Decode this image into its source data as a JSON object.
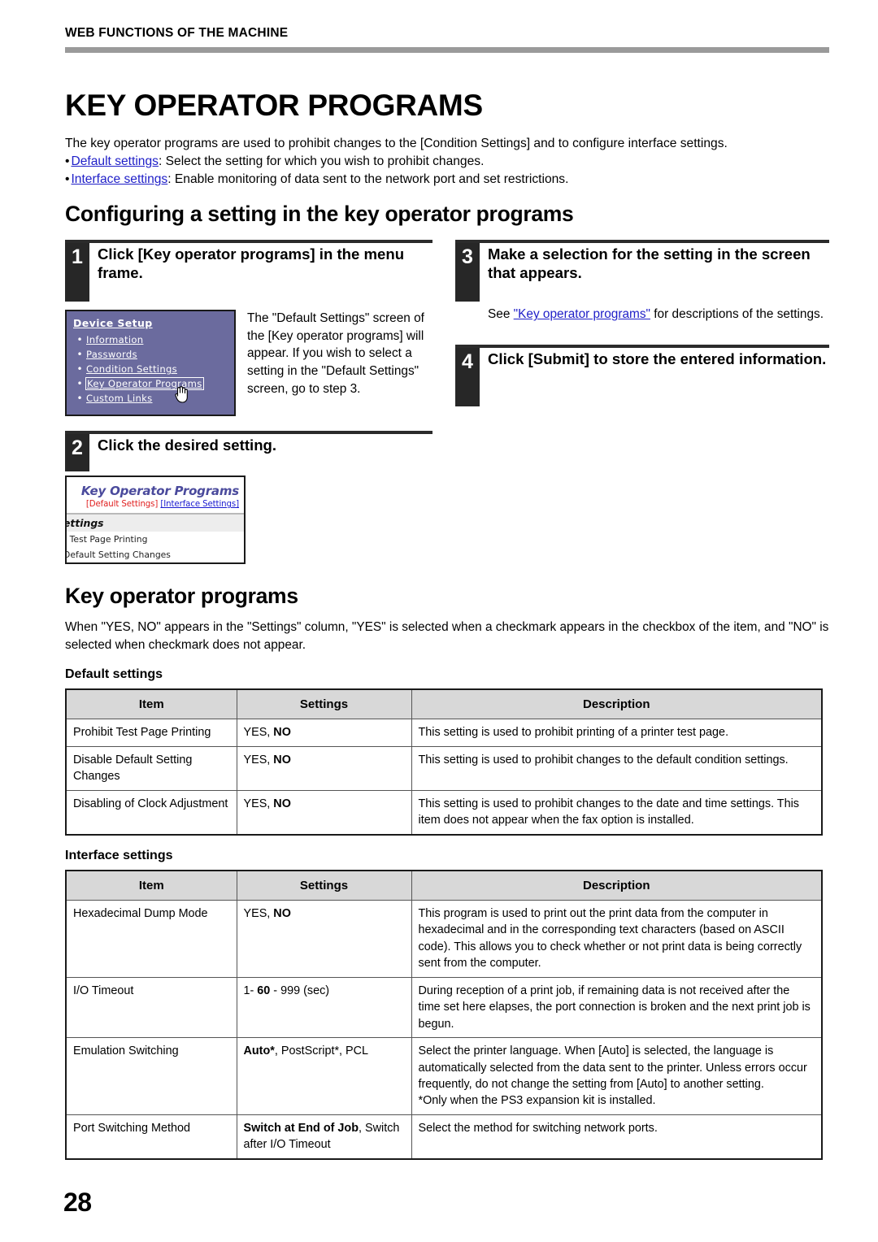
{
  "running_header": "WEB FUNCTIONS OF THE MACHINE",
  "doc_title": "KEY OPERATOR PROGRAMS",
  "intro": "The key operator programs are used to prohibit changes to the [Condition Settings] and to configure interface settings.",
  "bullets": [
    {
      "bullet": "•",
      "link": "Default settings",
      "rest": ": Select the setting for which you wish to prohibit changes."
    },
    {
      "bullet": "•",
      "link": "Interface settings",
      "rest": ": Enable monitoring of data sent to the network port and set restrictions."
    }
  ],
  "section_title": "Configuring a setting in the key operator programs",
  "steps": {
    "step1": {
      "num": "1",
      "title": "Click [Key operator programs] in the menu frame.",
      "caption": "The \"Default Settings\" screen of the [Key operator programs] will appear. If you wish to select a setting in the \"Default Settings\" screen, go to step 3."
    },
    "step2": {
      "num": "2",
      "title": "Click the desired setting."
    },
    "step3": {
      "num": "3",
      "title": "Make a selection for the setting in the screen that appears.",
      "body_pre": "See ",
      "body_link": "\"Key operator programs\"",
      "body_post": " for descriptions of the settings."
    },
    "step4": {
      "num": "4",
      "title": "Click [Submit] to store the entered information."
    }
  },
  "device_setup_shot": {
    "title": "Device Setup",
    "items": [
      {
        "bullet": "•",
        "label": "Information",
        "selected": false
      },
      {
        "bullet": "•",
        "label": "Passwords",
        "selected": false
      },
      {
        "bullet": "•",
        "label": "Condition Settings",
        "selected": false
      },
      {
        "bullet": "•",
        "label": "Key Operator Programs",
        "selected": true
      },
      {
        "bullet": "•",
        "label": "Custom Links",
        "selected": false
      }
    ],
    "cursor": "hand-cursor"
  },
  "kop_shot": {
    "title": "Key Operator Programs",
    "tab_active": "[Default Settings]",
    "tab_inactive": "[Interface Settings]",
    "subhead": "ettings",
    "rows": [
      "t Test Page Printing",
      "Default Setting Changes"
    ]
  },
  "kop_section": {
    "title": "Key operator programs",
    "paragraph": "When \"YES, NO\" appears in the \"Settings\" column, \"YES\" is selected when a checkmark appears in the checkbox of the item, and \"NO\" is selected when checkmark does not appear."
  },
  "tables": [
    {
      "caption": "Default settings",
      "headers": [
        "Item",
        "Settings",
        "Description"
      ],
      "rows": [
        {
          "item": "Prohibit Test Page Printing",
          "settings_plain": "YES, ",
          "settings_bold": "NO",
          "description": "This setting is used to prohibit printing of a printer test page."
        },
        {
          "item": "Disable Default Setting Changes",
          "settings_plain": "YES, ",
          "settings_bold": "NO",
          "description": "This setting is used to prohibit changes to the default condition settings."
        },
        {
          "item": "Disabling of Clock Adjustment",
          "settings_plain": "YES, ",
          "settings_bold": "NO",
          "description": "This setting is used to prohibit changes to the date and time settings. This item does not appear when the fax option is installed."
        }
      ]
    },
    {
      "caption": "Interface settings",
      "headers": [
        "Item",
        "Settings",
        "Description"
      ],
      "rows": [
        {
          "item": "Hexadecimal Dump Mode",
          "settings_plain": "YES, ",
          "settings_bold": "NO",
          "settings_tail": "",
          "description": "This program is used to print out the print data from the computer in hexadecimal and in the corresponding text characters (based on ASCII code). This allows you to check whether or not print data is being correctly sent from the computer."
        },
        {
          "item": "I/O Timeout",
          "settings_plain": "1- ",
          "settings_bold": "60",
          "settings_tail": " - 999 (sec)",
          "description": "During reception of a print job, if remaining data is not received after the time set here elapses, the port connection is broken and the next print job is begun."
        },
        {
          "item": "Emulation Switching",
          "settings_plain": "",
          "settings_bold": "Auto*",
          "settings_tail": ", PostScript*, PCL",
          "description": "Select the printer language. When [Auto] is selected, the language is automatically selected from the data sent to the printer. Unless errors occur frequently, do not change the setting from [Auto] to another setting.",
          "description_note": "*Only when the PS3 expansion kit is installed."
        },
        {
          "item": "Port Switching Method",
          "settings_plain": "",
          "settings_bold": "Switch at End of Job",
          "settings_tail": ", Switch after I/O Timeout",
          "description": "Select the method for switching network ports."
        }
      ]
    }
  ],
  "folio": "28"
}
